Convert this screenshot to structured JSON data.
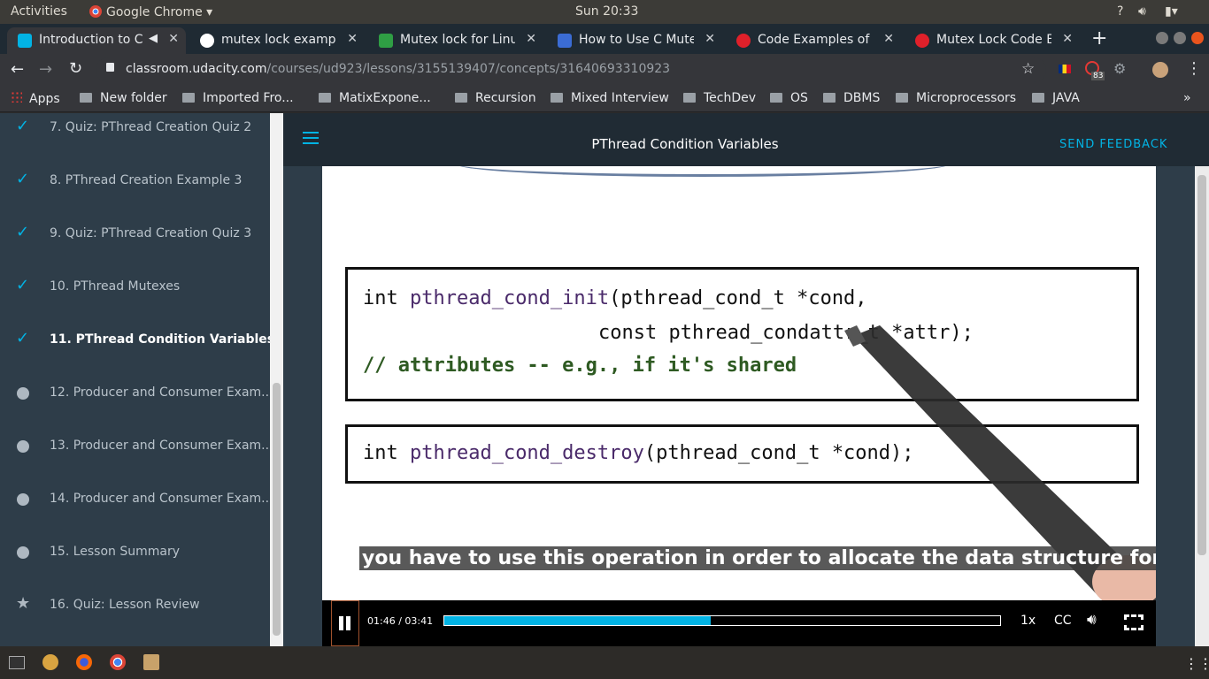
{
  "system": {
    "activities": "Activities",
    "app_name": "Google Chrome",
    "clock": "Sun 20:33",
    "help": "?"
  },
  "tabs": [
    {
      "title": "Introduction to C",
      "active": true,
      "favicon_color": "#02b3e4"
    },
    {
      "title": "mutex lock example",
      "active": false,
      "favicon_color": "#ffffff"
    },
    {
      "title": "Mutex lock for Linux",
      "active": false,
      "favicon_color": "#2f9e44"
    },
    {
      "title": "How to Use C Mutex",
      "active": false,
      "favicon_color": "#3b6cd4"
    },
    {
      "title": "Code Examples of M",
      "active": false,
      "favicon_color": "#e0202a"
    },
    {
      "title": "Mutex Lock Code Ex",
      "active": false,
      "favicon_color": "#e0202a"
    }
  ],
  "omnibox": {
    "domain": "classroom.udacity.com",
    "path": "/courses/ud923/lessons/3155139407/concepts/31640693310923",
    "extension_badge": "83"
  },
  "bookmarks": [
    "Apps",
    "New folder",
    "Imported Fro...",
    "MatixExpone...",
    "Recursion",
    "Mixed Interview",
    "TechDev",
    "OS",
    "DBMS",
    "Microprocessors",
    "JAVA"
  ],
  "sidebar": {
    "items": [
      {
        "label": "7. Quiz: PThread Creation Quiz 2",
        "status": "done"
      },
      {
        "label": "8. PThread Creation Example 3",
        "status": "done"
      },
      {
        "label": "9. Quiz: PThread Creation Quiz 3",
        "status": "done"
      },
      {
        "label": "10. PThread Mutexes",
        "status": "done"
      },
      {
        "label": "11. PThread Condition Variables",
        "status": "current"
      },
      {
        "label": "12. Producer and Consumer Exam...",
        "status": "todo"
      },
      {
        "label": "13. Producer and Consumer Exam...",
        "status": "todo"
      },
      {
        "label": "14. Producer and Consumer Exam...",
        "status": "todo"
      },
      {
        "label": "15. Lesson Summary",
        "status": "todo"
      },
      {
        "label": "16. Quiz: Lesson Review",
        "status": "star"
      }
    ]
  },
  "header": {
    "title": "PThread Condition Variables",
    "feedback": "SEND FEEDBACK"
  },
  "video": {
    "code1": {
      "line1_type": "int ",
      "line1_fn": "pthread_cond_init",
      "line1_args": "(pthread_cond_t *cond,",
      "line2": "const pthread_condattr_t *attr);",
      "line3": "// attributes -- e.g., if it's shared"
    },
    "code2": {
      "type": "int ",
      "fn": "pthread_cond_destroy",
      "args": "(pthread_cond_t *cond);"
    },
    "caption": "you have to use this operation in order to allocate the data structure for",
    "time": "01:46 / 03:41",
    "progress": 0.48,
    "speed": "1x",
    "cc": "CC"
  },
  "colors": {
    "accent": "#02b3e4",
    "sidebar_bg": "#2e3d49",
    "header_bg": "#202b34"
  }
}
